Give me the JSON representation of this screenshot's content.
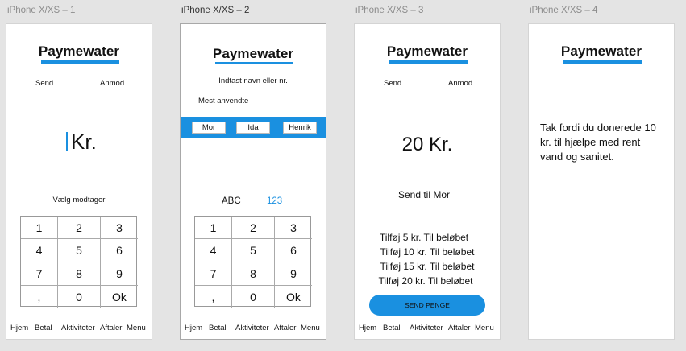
{
  "artboards": [
    "iPhone X/XS – 1",
    "iPhone X/XS – 2",
    "iPhone X/XS – 3",
    "iPhone X/XS – 4"
  ],
  "logo": "Paymewater",
  "tabs": {
    "send": "Send",
    "request": "Anmod"
  },
  "screen1": {
    "amount": "Kr.",
    "choose_recipient": "Vælg modtager"
  },
  "keypad": [
    "1",
    "2",
    "3",
    "4",
    "5",
    "6",
    "7",
    "8",
    "9",
    ",",
    "0",
    "Ok"
  ],
  "screen2": {
    "search_prompt": "Indtast navn eller nr.",
    "most_used": "Mest anvendte",
    "contacts": [
      "Mor",
      "Ida",
      "Henrik"
    ],
    "mode_abc": "ABC",
    "mode_123": "123"
  },
  "screen3": {
    "amount": "20 Kr.",
    "recipient": "Send til Mor",
    "add_options": [
      "Tilføj 5 kr. Til beløbet",
      "Tilføj 10 kr. Til beløbet",
      "Tilføj 15 kr. Til beløbet",
      "Tilføj 20 kr. Til beløbet"
    ],
    "send_button": "SEND PENGE"
  },
  "screen4": {
    "thanks": "Tak fordi du donerede 10 kr. til hjælpe med rent vand og sanitet."
  },
  "nav": [
    "Hjem",
    "Betal",
    "Aktiviteter",
    "Aftaler",
    "Menu"
  ],
  "colors": {
    "accent": "#1a90e0"
  }
}
